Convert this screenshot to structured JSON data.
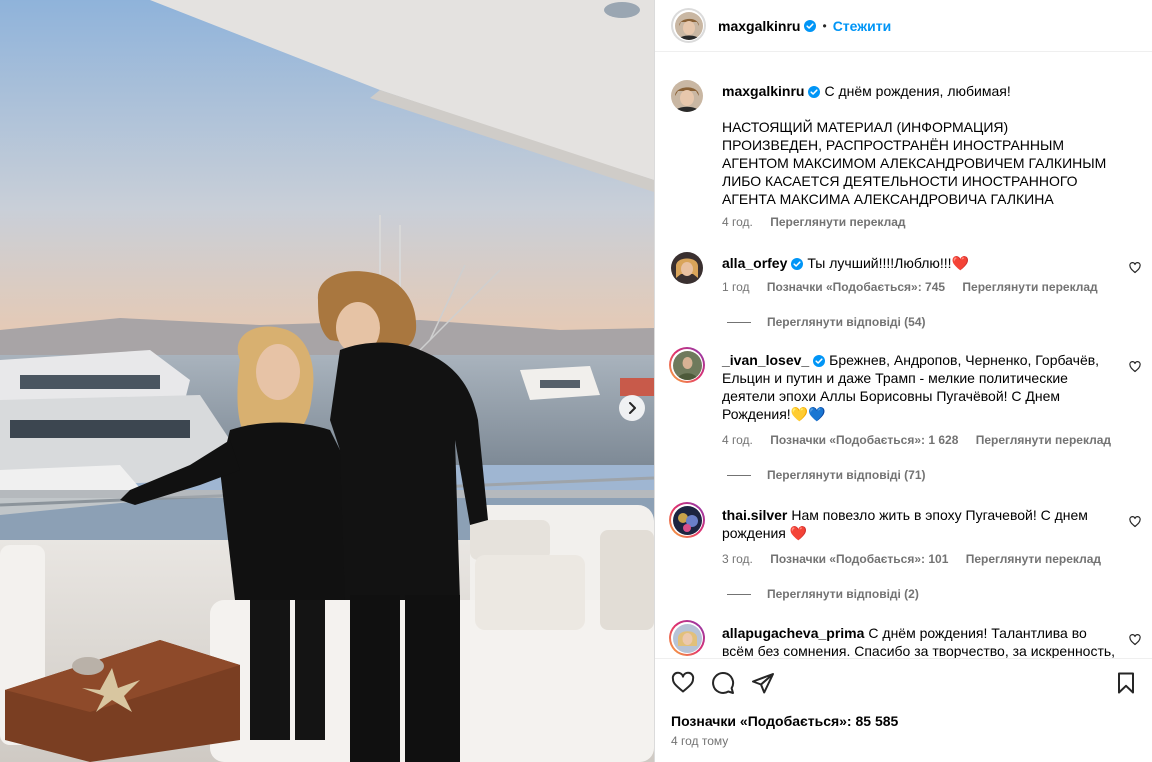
{
  "post": {
    "username": "maxgalkinru",
    "follow_label": "Стежити",
    "dot": "•"
  },
  "caption": {
    "username": "maxgalkinru",
    "text": "С днём рождения, любимая!",
    "notice": "НАСТОЯЩИЙ МАТЕРИАЛ (ИНФОРМАЦИЯ) ПРОИЗВЕДЕН, РАСПРОСТРАНЁН ИНОСТРАННЫМ АГЕНТОМ МАКСИМОМ АЛЕКСАНДРОВИЧЕМ ГАЛКИНЫМ ЛИБО КАСАЕТСЯ ДЕЯТЕЛЬНОСТИ ИНОСТРАННОГО АГЕНТА МАКСИМА АЛЕКСАНДРОВИЧА ГАЛКИНА",
    "time": "4 год.",
    "translate": "Переглянути переклад"
  },
  "comments": [
    {
      "username": "alla_orfey",
      "text": "Ты лучший!!!!Люблю!!!❤️",
      "time": "1 год",
      "likes": "Позначки «Подобається»: 745",
      "translate": "Переглянути переклад",
      "replies": "Переглянути відповіді (54)"
    },
    {
      "username": "_ivan_losev_",
      "text": "Брежнев, Андропов, Черненко, Горбачёв, Ельцин и путин и даже Трамп - мелкие политические деятели эпохи Аллы Борисовны Пугачёвой! С Днем Рождения!💛💙",
      "time": "4 год.",
      "likes": "Позначки «Подобається»: 1 628",
      "translate": "Переглянути переклад",
      "replies": "Переглянути відповіді (71)"
    },
    {
      "username": "thai.silver",
      "text": "Нам повезло жить в эпоху Пугачевой! С днем рождения ❤️",
      "time": "3 год.",
      "likes": "Позначки «Подобається»: 101",
      "translate": "Переглянути переклад",
      "replies": "Переглянути відповіді (2)"
    },
    {
      "username": "allapugacheva_prima",
      "text": "С днём рождения! Талантлива во всём без сомнения. Спасибо за творчество, за искренность, за"
    }
  ],
  "footer": {
    "likes": "Позначки «Подобається»: 85 585",
    "date": "4 год тому"
  },
  "colors": {
    "accent": "#0095f6",
    "verified": "#0095f6",
    "heart_red": "#ed4956",
    "muted": "#737373"
  },
  "icons": [
    "verified-badge-icon",
    "heart-icon",
    "comment-icon",
    "share-icon",
    "bookmark-icon",
    "chevron-right-icon"
  ]
}
